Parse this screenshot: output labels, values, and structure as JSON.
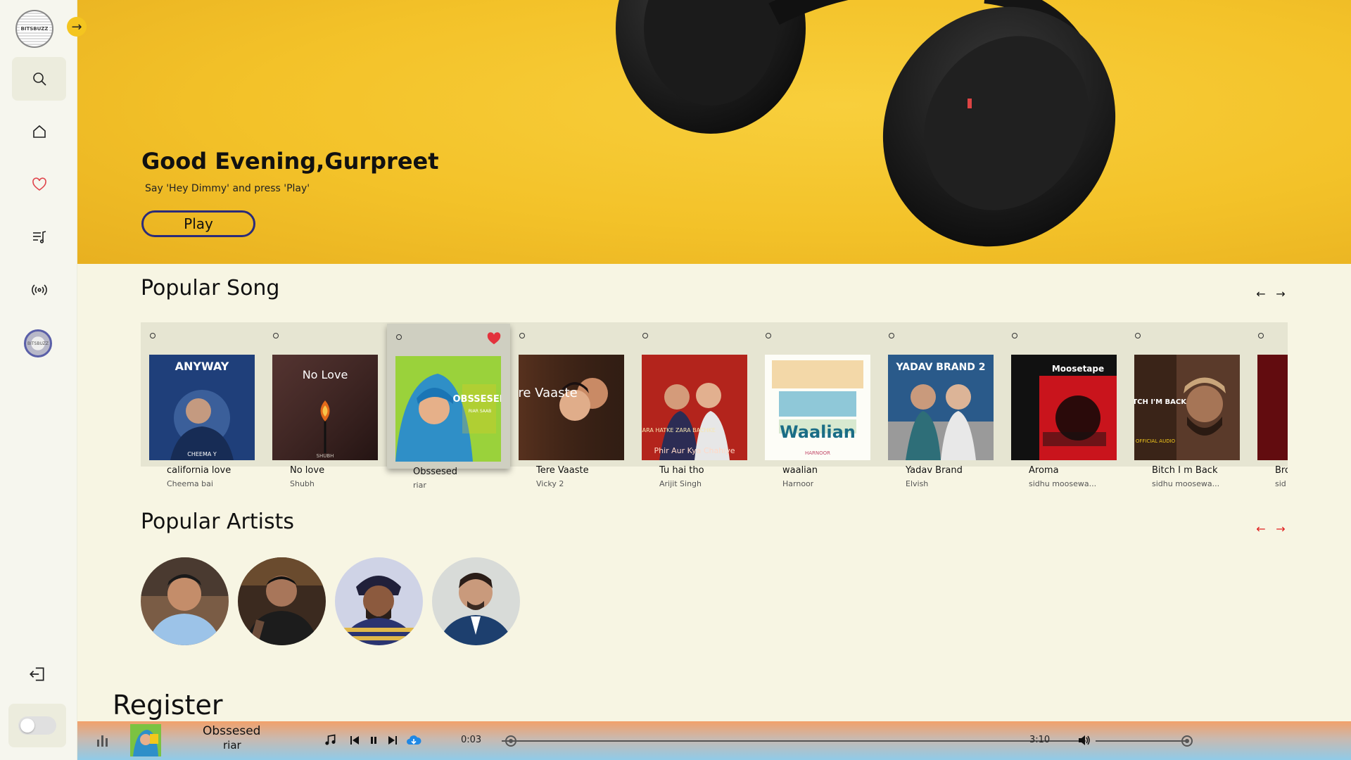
{
  "sidebar": {
    "logo_text": "BITSBUZZ",
    "avatar_text": "BITSBUZZ",
    "nav": [
      "search",
      "home",
      "favorites",
      "playlist",
      "radio"
    ]
  },
  "hero": {
    "greeting": "Good Evening,Gurpreet",
    "subtitle": "Say 'Hey Dimmy' and press 'Play'",
    "play_label": "Play"
  },
  "popular_songs": {
    "title": "Popular Song",
    "items": [
      {
        "name": "california love",
        "artist": "Cheema bai",
        "cover_text": "ANYWAY",
        "cover_sub": "CHEEMA Y"
      },
      {
        "name": "No love",
        "artist": "Shubh",
        "cover_text": "No Love",
        "cover_sub": "SHUBH"
      },
      {
        "name": "Obssesed",
        "artist": "riar",
        "cover_text": "OBSSESED",
        "cover_sub": "RIAR SAAB"
      },
      {
        "name": "Tere Vaaste",
        "artist": "Vicky 2",
        "cover_text": "Tere Vaaste",
        "cover_sub": ""
      },
      {
        "name": "Tu hai tho",
        "artist": "Arijit Singh",
        "cover_text": "Phir Aur Kya Chahiye",
        "cover_sub": "ZARA HATKE ZARA BACHKE"
      },
      {
        "name": "waalian",
        "artist": "Harnoor",
        "cover_text": "Waalian",
        "cover_sub": "HARNOOR"
      },
      {
        "name": "Yadav Brand",
        "artist": "Elvish",
        "cover_text": "YADAV BRAND 2",
        "cover_sub": ""
      },
      {
        "name": "Aroma",
        "artist": "sidhu moosewa...",
        "cover_text": "Moosetape",
        "cover_sub": ""
      },
      {
        "name": "Bitch I m Back",
        "artist": "sidhu moosewa...",
        "cover_text": "BITCH I'M BACK",
        "cover_sub": "OFFICIAL AUDIO"
      },
      {
        "name": "Bro",
        "artist": "sid",
        "cover_text": "",
        "cover_sub": ""
      }
    ]
  },
  "popular_artists": {
    "title": "Popular Artists",
    "count": 4
  },
  "register_label": "Register",
  "player": {
    "title": "Obssesed",
    "artist": "riar",
    "current_time": "0:03",
    "duration": "3:10",
    "progress": 0.016,
    "volume": 0.99
  },
  "colors": {
    "accent": "#f3c229",
    "nav_heart": "#e0454c",
    "artist_arrows": "#e02020",
    "download": "#1e88e5"
  }
}
